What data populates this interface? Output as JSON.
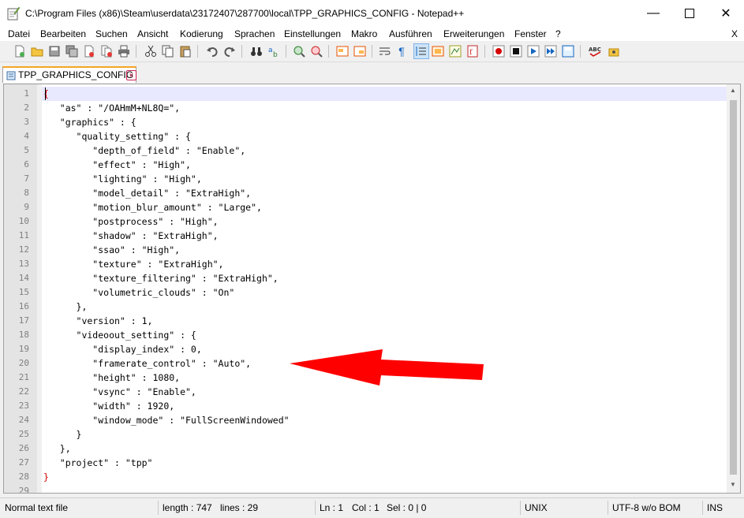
{
  "window": {
    "title": "C:\\Program Files (x86)\\Steam\\userdata\\23172407\\287700\\local\\TPP_GRAPHICS_CONFIG - Notepad++",
    "minimize_icon": "minimize-icon",
    "maximize_icon": "maximize-icon",
    "close_icon": "close-icon"
  },
  "menu": {
    "items": [
      "Datei",
      "Bearbeiten",
      "Suchen",
      "Ansicht",
      "Kodierung",
      "Sprachen",
      "Einstellungen",
      "Makro",
      "Ausführen",
      "Erweiterungen",
      "Fenster",
      "?"
    ],
    "close_label": "X"
  },
  "tab": {
    "label": "TPP_GRAPHICS_CONFIG",
    "close_glyph": "x"
  },
  "editor": {
    "lines": [
      "{",
      "   \"as\" : \"/OAHmM+NL8Q=\",",
      "   \"graphics\" : {",
      "      \"quality_setting\" : {",
      "         \"depth_of_field\" : \"Enable\",",
      "         \"effect\" : \"High\",",
      "         \"lighting\" : \"High\",",
      "         \"model_detail\" : \"ExtraHigh\",",
      "         \"motion_blur_amount\" : \"Large\",",
      "         \"postprocess\" : \"High\",",
      "         \"shadow\" : \"ExtraHigh\",",
      "         \"ssao\" : \"High\",",
      "         \"texture\" : \"ExtraHigh\",",
      "         \"texture_filtering\" : \"ExtraHigh\",",
      "         \"volumetric_clouds\" : \"On\"",
      "      },",
      "      \"version\" : 1,",
      "      \"videoout_setting\" : {",
      "         \"display_index\" : 0,",
      "         \"framerate_control\" : \"Auto\",",
      "         \"height\" : 1080,",
      "         \"vsync\" : \"Enable\",",
      "         \"width\" : 1920,",
      "         \"window_mode\" : \"FullScreenWindowed\"",
      "      }",
      "   },",
      "   \"project\" : \"tpp\"",
      "}",
      ""
    ],
    "line_numbers": [
      "1",
      "2",
      "3",
      "4",
      "5",
      "6",
      "7",
      "8",
      "9",
      "10",
      "11",
      "12",
      "13",
      "14",
      "15",
      "16",
      "17",
      "18",
      "19",
      "20",
      "21",
      "22",
      "23",
      "24",
      "25",
      "26",
      "27",
      "28",
      "29"
    ]
  },
  "annotation": {
    "arrow_color": "#ff0000",
    "arrow_icon": "red-arrow-annotation"
  },
  "status": {
    "file_type": "Normal text file",
    "length": "length : 747",
    "lines": "lines : 29",
    "ln": "Ln : 1",
    "col": "Col : 1",
    "sel": "Sel : 0 | 0",
    "eol": "UNIX",
    "encoding": "UTF-8 w/o BOM",
    "mode": "INS"
  },
  "colors": {
    "tab_accent": "#f5a623",
    "current_line": "#e8e8ff",
    "brace": "#d00000"
  }
}
